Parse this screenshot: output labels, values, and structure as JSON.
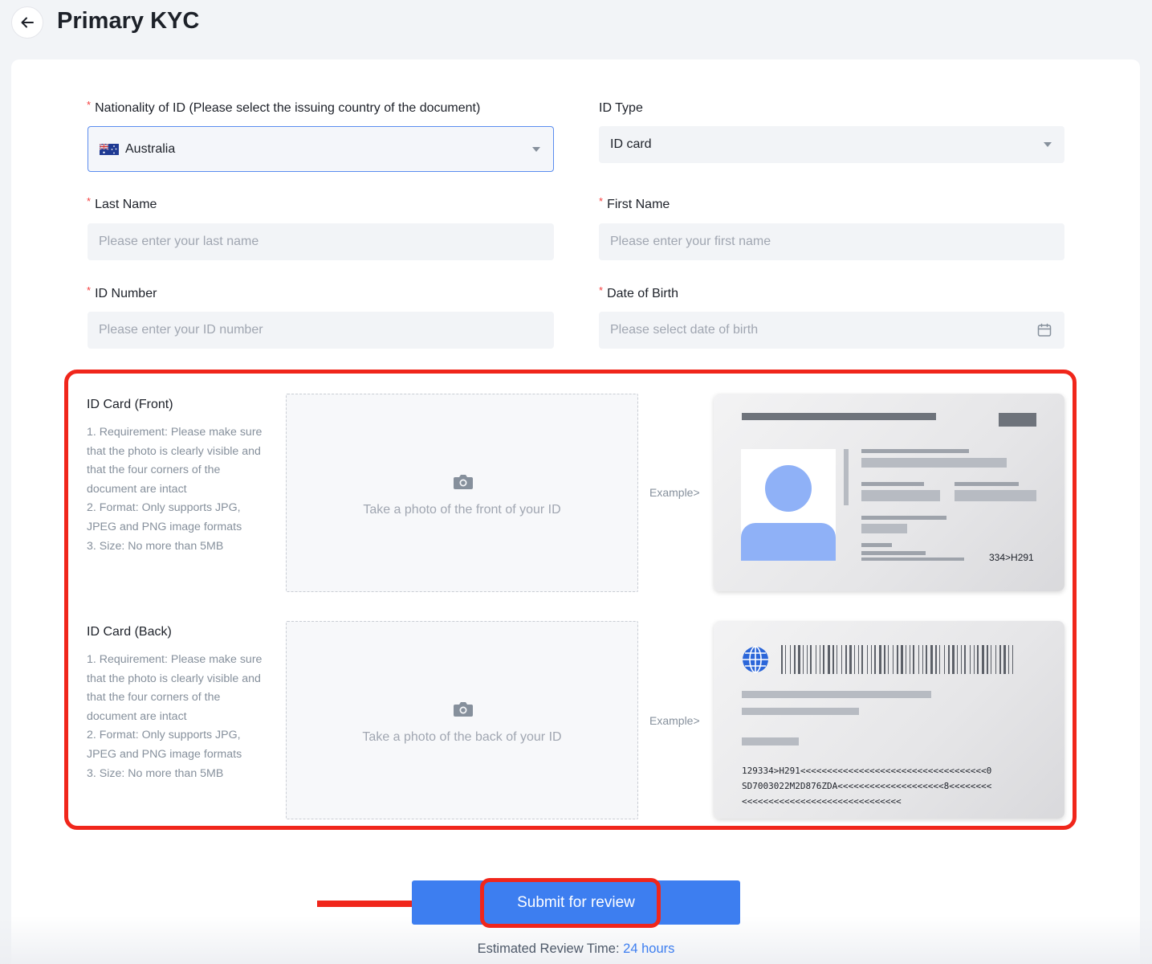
{
  "header": {
    "title": "Primary KYC"
  },
  "form": {
    "nationality": {
      "required_mark": "*",
      "label": "Nationality of ID (Please select the issuing country of the document)",
      "value": "Australia"
    },
    "id_type": {
      "label": "ID Type",
      "value": "ID card"
    },
    "last_name": {
      "required_mark": "*",
      "label": "Last Name",
      "placeholder": "Please enter your last name"
    },
    "first_name": {
      "required_mark": "*",
      "label": "First Name",
      "placeholder": "Please enter your first name"
    },
    "id_number": {
      "required_mark": "*",
      "label": "ID Number",
      "placeholder": "Please enter your ID number"
    },
    "dob": {
      "required_mark": "*",
      "label": "Date of Birth",
      "placeholder": "Please select date of birth"
    }
  },
  "uploads": {
    "front": {
      "title": "ID Card (Front)",
      "requirements": [
        "1. Requirement: Please make sure that the photo is clearly visible and that the four corners of the document are intact",
        "2. Format: Only supports JPG, JPEG and PNG image formats",
        "3. Size: No more than 5MB"
      ],
      "drop_text": "Take a photo of the front of your ID",
      "example_label": "Example>",
      "sample_code": "334>H291"
    },
    "back": {
      "title": "ID Card (Back)",
      "requirements": [
        "1. Requirement: Please make sure that the photo is clearly visible and that the four corners of the document are intact",
        "2. Format: Only supports JPG, JPEG and PNG image formats",
        "3. Size: No more than 5MB"
      ],
      "drop_text": "Take a photo of the back of your ID",
      "example_label": "Example>",
      "mrz_lines": [
        "129334>H291<<<<<<<<<<<<<<<<<<<<<<<<<<<<<<<<<<<0",
        "SD7003022M2D876ZDA<<<<<<<<<<<<<<<<<<<<8<<<<<<<<",
        "<<<<<<<<<<<<<<<<<<<<<<<<<<<<<<"
      ]
    }
  },
  "actions": {
    "submit_label": "Submit for review",
    "review_prefix": "Estimated Review Time:",
    "review_value": "24 hours"
  },
  "colors": {
    "primary": "#3d7ef0",
    "highlight": "#f0261b",
    "required": "#f53f3f",
    "placeholder": "#a0a6b1"
  },
  "icons": [
    "back-arrow-icon",
    "caret-down-icon",
    "calendar-icon",
    "camera-icon",
    "australia-flag-icon",
    "globe-icon",
    "barcode-icon"
  ]
}
